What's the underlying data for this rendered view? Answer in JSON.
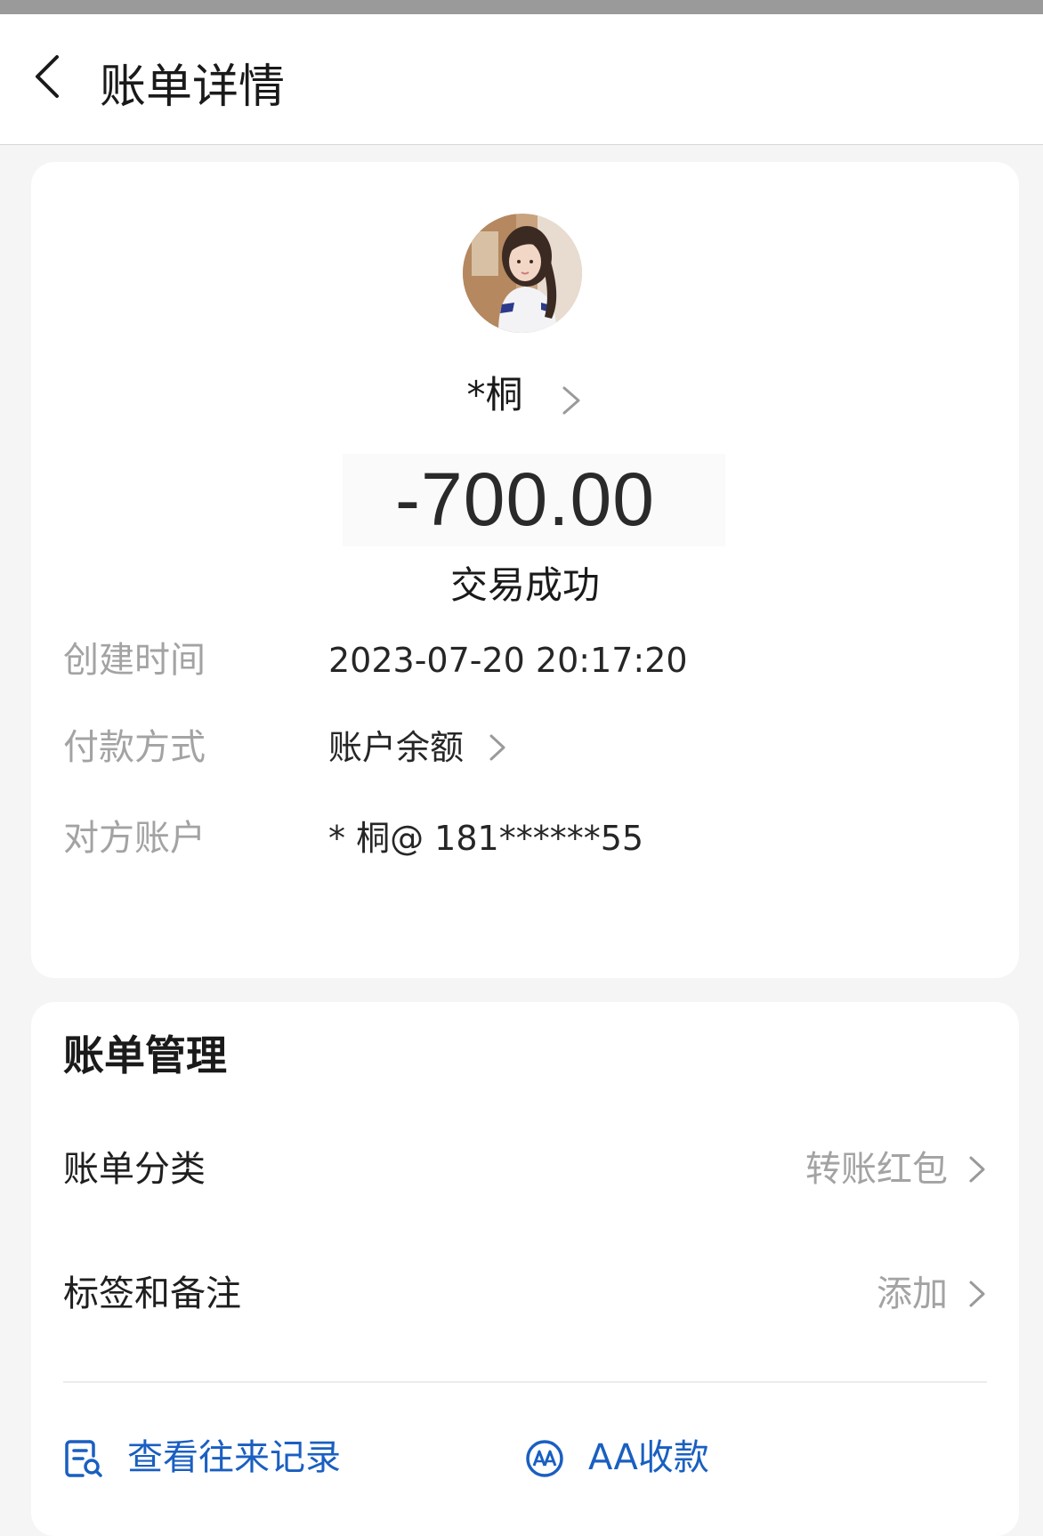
{
  "header": {
    "title": "账单详情",
    "back_icon": "chevron-left-icon"
  },
  "transaction": {
    "payee_name": "*桐",
    "amount": "-700.00",
    "status": "交易成功"
  },
  "details": [
    {
      "label": "创建时间",
      "value": "2023-07-20 20:17:20"
    },
    {
      "label": "付款方式",
      "value": "账户余额"
    },
    {
      "label": "对方账户",
      "value": "* 桐@ 181******55"
    }
  ],
  "management": {
    "title": "账单管理",
    "rows": [
      {
        "label": "账单分类",
        "value": "转账红包"
      },
      {
        "label": "标签和备注",
        "value": "添加"
      }
    ],
    "actions": [
      {
        "label": "查看往来记录",
        "icon": "records-search-icon"
      },
      {
        "label": "AA收款",
        "icon": "aa-collect-icon"
      }
    ]
  },
  "colors": {
    "background": "#f5f5f5",
    "card": "#ffffff",
    "link_blue": "#1a5fc1",
    "label_gray": "#a3a3a3"
  }
}
